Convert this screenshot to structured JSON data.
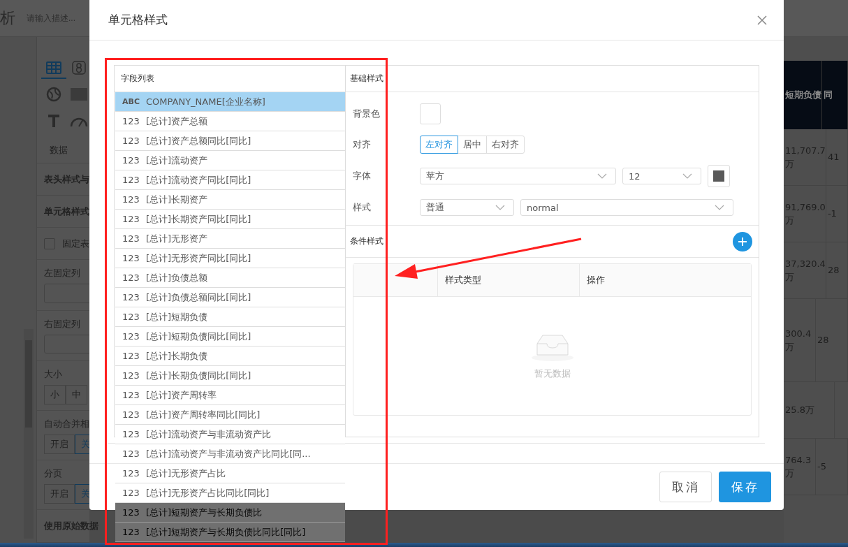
{
  "app_header": {
    "title": "析",
    "description_placeholder": "请输入描述..."
  },
  "side_panel": {
    "chart_types": [
      {
        "kind": "table",
        "selected": true
      },
      {
        "kind": "number",
        "selected": false
      },
      {
        "kind": "globe",
        "selected": false
      },
      {
        "kind": "card",
        "selected": false
      },
      {
        "kind": "text",
        "selected": false
      },
      {
        "kind": "gauge",
        "selected": false
      }
    ],
    "tab": "数据",
    "sections": [
      {
        "kind": "heading",
        "label": "表头样式与"
      },
      {
        "kind": "heading",
        "label": "单元格样式"
      },
      {
        "kind": "checkbox",
        "label": "固定表",
        "checked": false
      },
      {
        "kind": "field",
        "label": "左固定列"
      },
      {
        "kind": "field",
        "label": "右固定列"
      },
      {
        "kind": "buttons",
        "label": "大小",
        "options": [
          {
            "label": "小",
            "selected": false
          },
          {
            "label": "中",
            "selected": false
          }
        ]
      },
      {
        "kind": "buttons",
        "label": "自动合并相",
        "options": [
          {
            "label": "开启",
            "selected": false
          },
          {
            "label": "关",
            "selected": true
          }
        ]
      },
      {
        "kind": "buttons",
        "label": "分页",
        "options": [
          {
            "label": "开启",
            "selected": false
          },
          {
            "label": "关",
            "selected": true
          }
        ]
      },
      {
        "kind": "heading",
        "label": "使用原始数据"
      }
    ]
  },
  "report_table": {
    "columns": [
      "短期负债",
      "同"
    ],
    "rows": [
      [
        "11,707.7万",
        "41"
      ],
      [
        "91,769.0万",
        "-1"
      ],
      [
        "37,320.4万",
        "28"
      ],
      [
        "300.4万",
        "28"
      ],
      [
        "25.8万"
      ],
      [
        "764.3万",
        "-5"
      ]
    ]
  },
  "dialog": {
    "title": "单元格样式",
    "field_list": {
      "title": "字段列表",
      "items": [
        {
          "type": "ABC",
          "label": "COMPANY_NAME[企业名称]",
          "selected": true
        },
        {
          "type": "123",
          "label": "[总计]资产总额",
          "selected": false
        },
        {
          "type": "123",
          "label": "[总计]资产总额同比[同比]",
          "selected": false
        },
        {
          "type": "123",
          "label": "[总计]流动资产",
          "selected": false
        },
        {
          "type": "123",
          "label": "[总计]流动资产同比[同比]",
          "selected": false
        },
        {
          "type": "123",
          "label": "[总计]长期资产",
          "selected": false
        },
        {
          "type": "123",
          "label": "[总计]长期资产同比[同比]",
          "selected": false
        },
        {
          "type": "123",
          "label": "[总计]无形资产",
          "selected": false
        },
        {
          "type": "123",
          "label": "[总计]无形资产同比[同比]",
          "selected": false
        },
        {
          "type": "123",
          "label": "[总计]负债总额",
          "selected": false
        },
        {
          "type": "123",
          "label": "[总计]负债总额同比[同比]",
          "selected": false
        },
        {
          "type": "123",
          "label": "[总计]短期负债",
          "selected": false
        },
        {
          "type": "123",
          "label": "[总计]短期负债同比[同比]",
          "selected": false
        },
        {
          "type": "123",
          "label": "[总计]长期负债",
          "selected": false
        },
        {
          "type": "123",
          "label": "[总计]长期负债同比[同比]",
          "selected": false
        },
        {
          "type": "123",
          "label": "[总计]资产周转率",
          "selected": false
        },
        {
          "type": "123",
          "label": "[总计]资产周转率同比[同比]",
          "selected": false
        },
        {
          "type": "123",
          "label": "[总计]流动资产与非流动资产比",
          "selected": false
        },
        {
          "type": "123",
          "label": "[总计]流动资产与非流动资产比同比[同...",
          "selected": false
        },
        {
          "type": "123",
          "label": "[总计]无形资产占比",
          "selected": false
        },
        {
          "type": "123",
          "label": "[总计]无形资产占比同比[同比]",
          "selected": false
        },
        {
          "type": "123",
          "label": "[总计]短期资产与长期负债比",
          "selected": false
        },
        {
          "type": "123",
          "label": "[总计]短期资产与长期负债比同比[同比]",
          "selected": false
        }
      ]
    },
    "basic_style": {
      "title": "基础样式",
      "background_label": "背景色",
      "align_label": "对齐",
      "align_options": [
        {
          "label": "左对齐",
          "selected": true
        },
        {
          "label": "居中",
          "selected": false
        },
        {
          "label": "右对齐",
          "selected": false
        }
      ],
      "font_label": "字体",
      "font_family": "苹方",
      "font_size": "12",
      "style_label": "样式",
      "font_weight": "普通",
      "font_style": "normal"
    },
    "conditional_style": {
      "title": "条件样式",
      "columns": [
        "样式类型",
        "操作"
      ],
      "empty_text": "暂无数据"
    },
    "buttons": [
      {
        "label": "取消",
        "kind": "default"
      },
      {
        "label": "保存",
        "kind": "primary"
      }
    ]
  }
}
